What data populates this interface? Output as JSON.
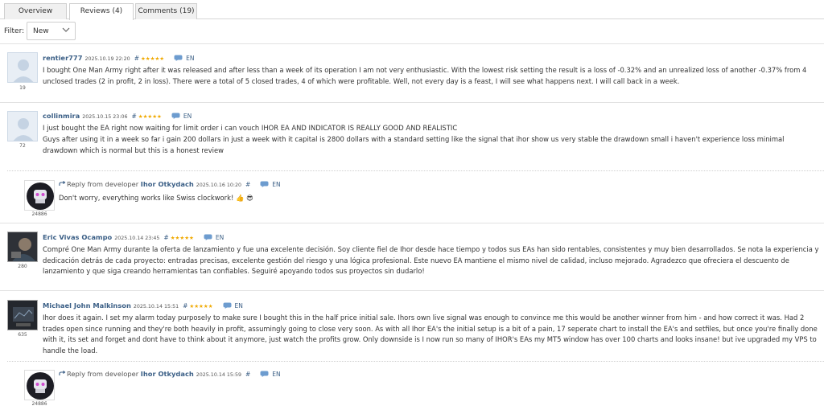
{
  "tabs": [
    {
      "label": "Overview"
    },
    {
      "label": "Reviews (4)"
    },
    {
      "label": "Comments (19)"
    }
  ],
  "filter": {
    "label": "Filter:",
    "value": "New"
  },
  "colors": {
    "author": "#3b5f86",
    "stars": "#f0a900",
    "border": "#e2e2e2"
  },
  "reviews": [
    {
      "author": "rentier777",
      "date": "2025.10.19 22:20",
      "hash": "#",
      "stars": "★★★★★",
      "rating": 4.5,
      "lang": "EN",
      "count": "19",
      "text": "I bought One Man Army right after it was released and after less than a week of its operation I am not very enthusiastic. With the lowest risk setting the result is a loss of -0.32% and an unrealized loss of another -0.37% from 4 unclosed trades (2 in profit, 2 in loss). There were a total of 5 closed trades, 4 of which were profitable. Well, not every day is a feast, I will see what happens next. I will call back in a week."
    },
    {
      "author": "collinmira",
      "date": "2025.10.15 23:06",
      "hash": "#",
      "stars": "★★★★★",
      "rating": 5,
      "lang": "EN",
      "count": "72",
      "text_line1": "I just bought the EA right now waiting for limit order i can vouch IHOR EA AND INDICATOR IS REALLY GOOD AND REALISTIC",
      "text": "Guys after using it in a week so far i gain 200 dollars in just a week with it capital is 2800 dollars with a standard setting like the signal that ihor show us very stable the drawdown small i haven't experience loss minimal drawdown which is normal but this is a honest review",
      "reply": {
        "prefix": "Reply from developer",
        "author": "Ihor Otkydach",
        "date": "2025.10.16 10:20",
        "hash": "#",
        "lang": "EN",
        "count": "24886",
        "text": "Don't worry, everything works like Swiss clockwork! 👍 😎"
      }
    },
    {
      "author": "Eric Vivas Ocampo",
      "date": "2025.10.14 23:45",
      "hash": "#",
      "stars": "★★★★★",
      "rating": 5,
      "lang": "EN",
      "count": "280",
      "text": "Compré One Man Army durante la oferta de lanzamiento y fue una excelente decisión. Soy cliente fiel de Ihor desde hace tiempo y todos sus EAs han sido rentables, consistentes y muy bien desarrollados. Se nota la experiencia y dedicación detrás de cada proyecto: entradas precisas, excelente gestión del riesgo y una lógica profesional. Este nuevo EA mantiene el mismo nivel de calidad, incluso mejorado. Agradezco que ofreciera el descuento de lanzamiento y que siga creando herramientas tan confiables. Seguiré apoyando todos sus proyectos sin dudarlo!"
    },
    {
      "author": "Michael John Malkinson",
      "date": "2025.10.14 15:51",
      "hash": "#",
      "stars": "★★★★★",
      "rating": 5,
      "lang": "EN",
      "count": "635",
      "text": "Ihor does it again. I set my alarm today purposely to make sure I bought this in the half price initial sale. Ihors own live signal was enough to convince me this would be another winner from him - and how correct it was. Had 2 trades open since running and they're both heavily in profit, assumingly going to close very soon. As with all Ihor EA's the initial setup is a bit of a pain, 17 seperate chart to install the EA's and setfiles, but once you're finally done with it, its set and forget and dont have to think about it anymore, just watch the profits grow. Only downside is I now run so many of IHOR's EAs my MT5 window has over 100 charts and looks insane! but ive upgraded my VPS to handle the load.",
      "reply": {
        "prefix": "Reply from developer",
        "author": "Ihor Otkydach",
        "date": "2025.10.14 15:59",
        "hash": "#",
        "lang": "EN",
        "count": "24886"
      }
    }
  ]
}
